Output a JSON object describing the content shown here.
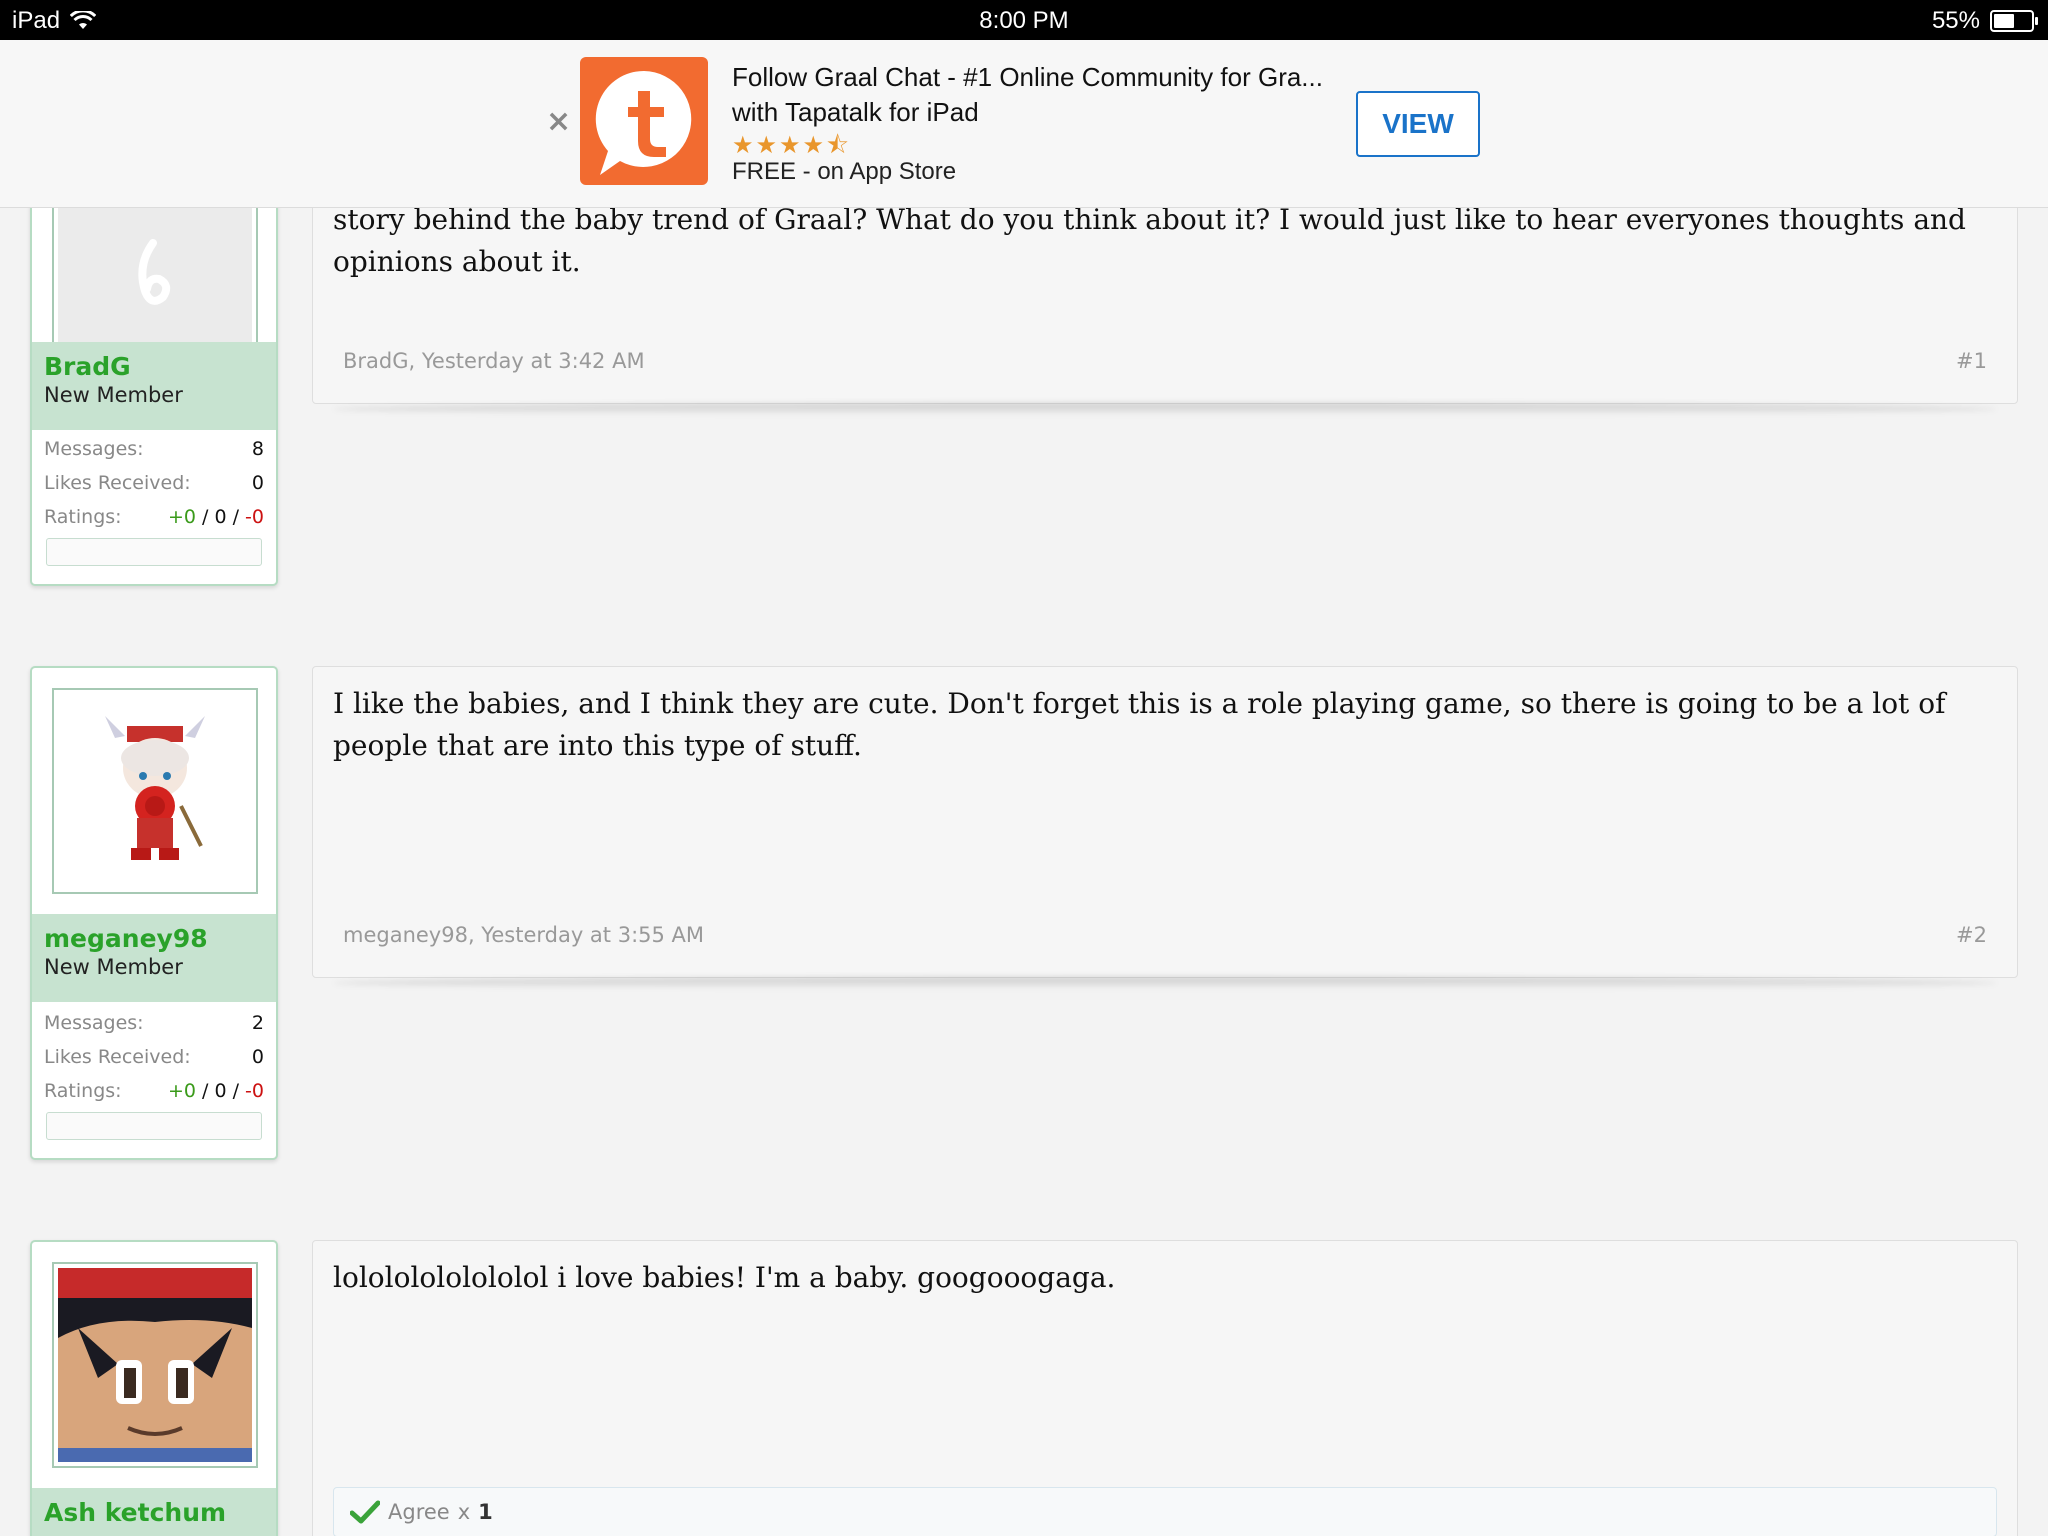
{
  "status_bar": {
    "device": "iPad",
    "time": "8:00 PM",
    "battery": "55%",
    "battery_level": 0.55
  },
  "ad": {
    "title_line1": "Follow Graal Chat - #1 Online Community for Gra...",
    "title_line2": "with Tapatalk for iPad",
    "rating": 4.5,
    "stars": "★★★★⯪",
    "price": "FREE - on App Store",
    "view_label": "VIEW",
    "close_glyph": "×",
    "logo_icon": "tapatalk-logo",
    "logo_color": "#f26b30",
    "accent_color": "#1a73c9"
  },
  "posts": [
    {
      "username": "BradG",
      "user_title": "New Member",
      "labels": {
        "messages": "Messages:",
        "likes": "Likes Received:",
        "ratings": "Ratings:"
      },
      "messages": "8",
      "likes_received": "0",
      "rating_pos": "+0",
      "rating_neutral": "0",
      "rating_neg": "-0",
      "body": "story behind the baby trend of Graal? What do you think about it? I would just like to hear everyones thoughts and opinions about it.",
      "author_time": "BradG, Yesterday at 3:42 AM",
      "post_number": "#1"
    },
    {
      "username": "meganey98",
      "user_title": "New Member",
      "labels": {
        "messages": "Messages:",
        "likes": "Likes Received:",
        "ratings": "Ratings:"
      },
      "messages": "2",
      "likes_received": "0",
      "rating_pos": "+0",
      "rating_neutral": "0",
      "rating_neg": "-0",
      "body": "I like the babies, and I think they are cute. Don't forget this is a role playing game, so there is going to be a lot of people that are into this type of stuff.",
      "author_time": "meganey98, Yesterday at 3:55 AM",
      "post_number": "#2"
    },
    {
      "username": "Ash ketchum",
      "body": "lolololololololol i love babies! I'm a baby. googooogaga.",
      "agree_label": "Agree",
      "agree_count": "1"
    }
  ],
  "colors": {
    "username": "#2aa22a",
    "user_panel": "#c7e3d0",
    "rating_positive": "#3a9a1a",
    "rating_negative": "#cc1111"
  }
}
